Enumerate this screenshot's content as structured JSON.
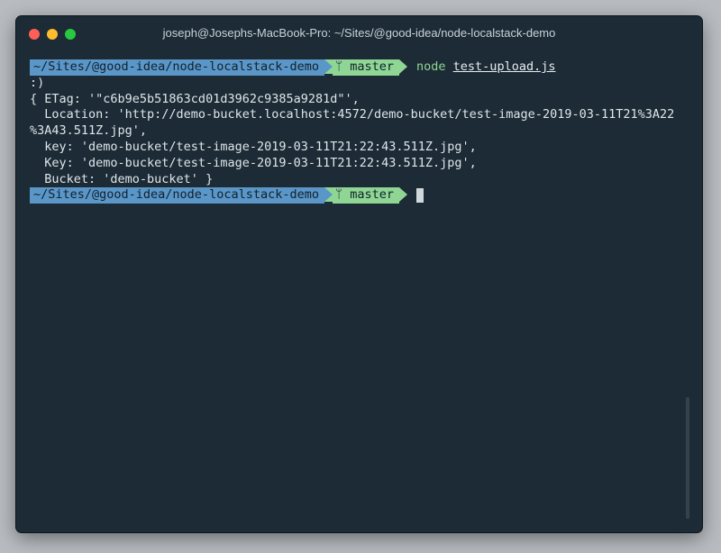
{
  "window": {
    "title": "joseph@Josephs-MacBook-Pro: ~/Sites/@good-idea/node-localstack-demo"
  },
  "prompt": {
    "path": "~/Sites/@good-idea/node-localstack-demo",
    "branch_icon": "git-branch-icon",
    "branch_glyph": "ᛘ",
    "branch": "master"
  },
  "command": {
    "program": "node",
    "argument": "test-upload.js"
  },
  "output": [
    ":)",
    "{ ETag: '\"c6b9e5b51863cd01d3962c9385a9281d\"',",
    "  Location: 'http://demo-bucket.localhost:4572/demo-bucket/test-image-2019-03-11T21%3A22",
    "%3A43.511Z.jpg',",
    "  key: 'demo-bucket/test-image-2019-03-11T21:22:43.511Z.jpg',",
    "  Key: 'demo-bucket/test-image-2019-03-11T21:22:43.511Z.jpg',",
    "  Bucket: 'demo-bucket' }"
  ],
  "colors": {
    "background": "#1c2b35",
    "path_segment": "#5b96c8",
    "git_segment": "#8fd694",
    "command": "#8fd694",
    "text": "#dfe6ea"
  }
}
